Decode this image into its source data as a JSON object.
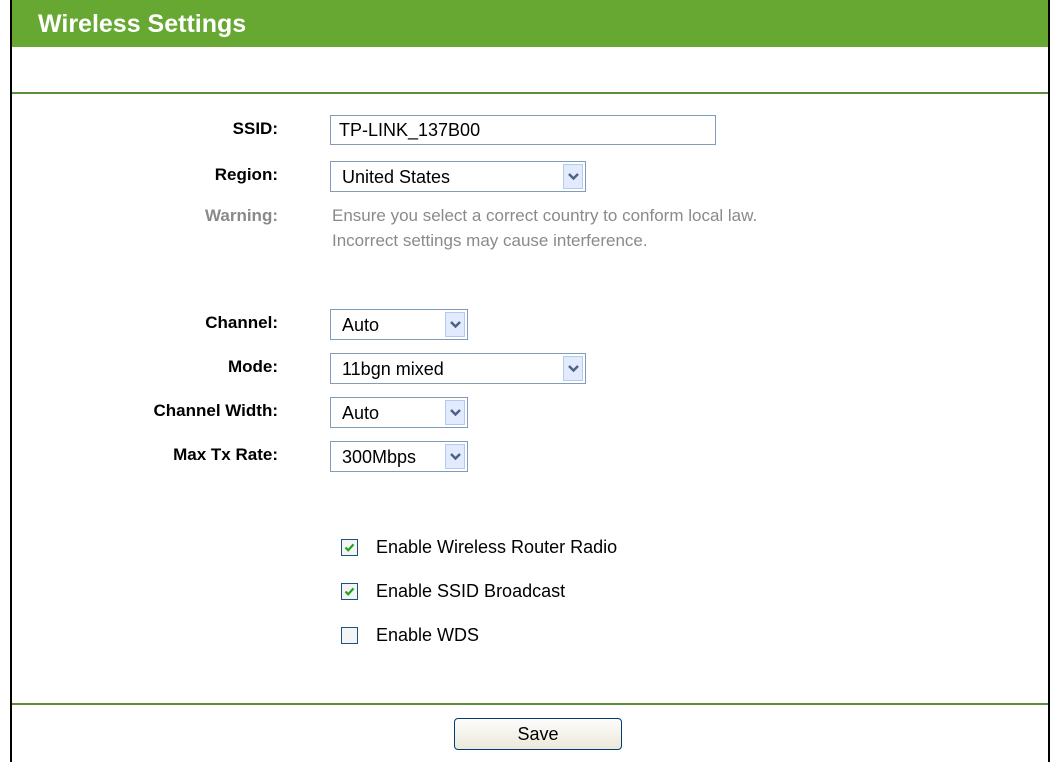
{
  "header": {
    "title": "Wireless Settings"
  },
  "form": {
    "ssid": {
      "label": "SSID:",
      "value": "TP-LINK_137B00"
    },
    "region": {
      "label": "Region:",
      "value": "United States"
    },
    "warning": {
      "label": "Warning:",
      "line1": "Ensure you select a correct country to conform local law.",
      "line2": "Incorrect settings may cause interference."
    },
    "channel": {
      "label": "Channel:",
      "value": "Auto"
    },
    "mode": {
      "label": "Mode:",
      "value": "11bgn mixed"
    },
    "channel_width": {
      "label": "Channel Width:",
      "value": "Auto"
    },
    "max_tx_rate": {
      "label": "Max Tx Rate:",
      "value": "300Mbps"
    }
  },
  "options": [
    {
      "label": "Enable Wireless Router Radio",
      "checked": true
    },
    {
      "label": "Enable SSID Broadcast",
      "checked": true
    },
    {
      "label": "Enable WDS",
      "checked": false
    }
  ],
  "footer": {
    "save_label": "Save"
  },
  "colors": {
    "header_bg": "#66a832",
    "divider": "#5c8f3c",
    "warning_text": "#8a8a8a",
    "check": "#21a121"
  },
  "icons": {
    "dropdown": "chevron-down-icon",
    "check": "checkmark-icon"
  }
}
